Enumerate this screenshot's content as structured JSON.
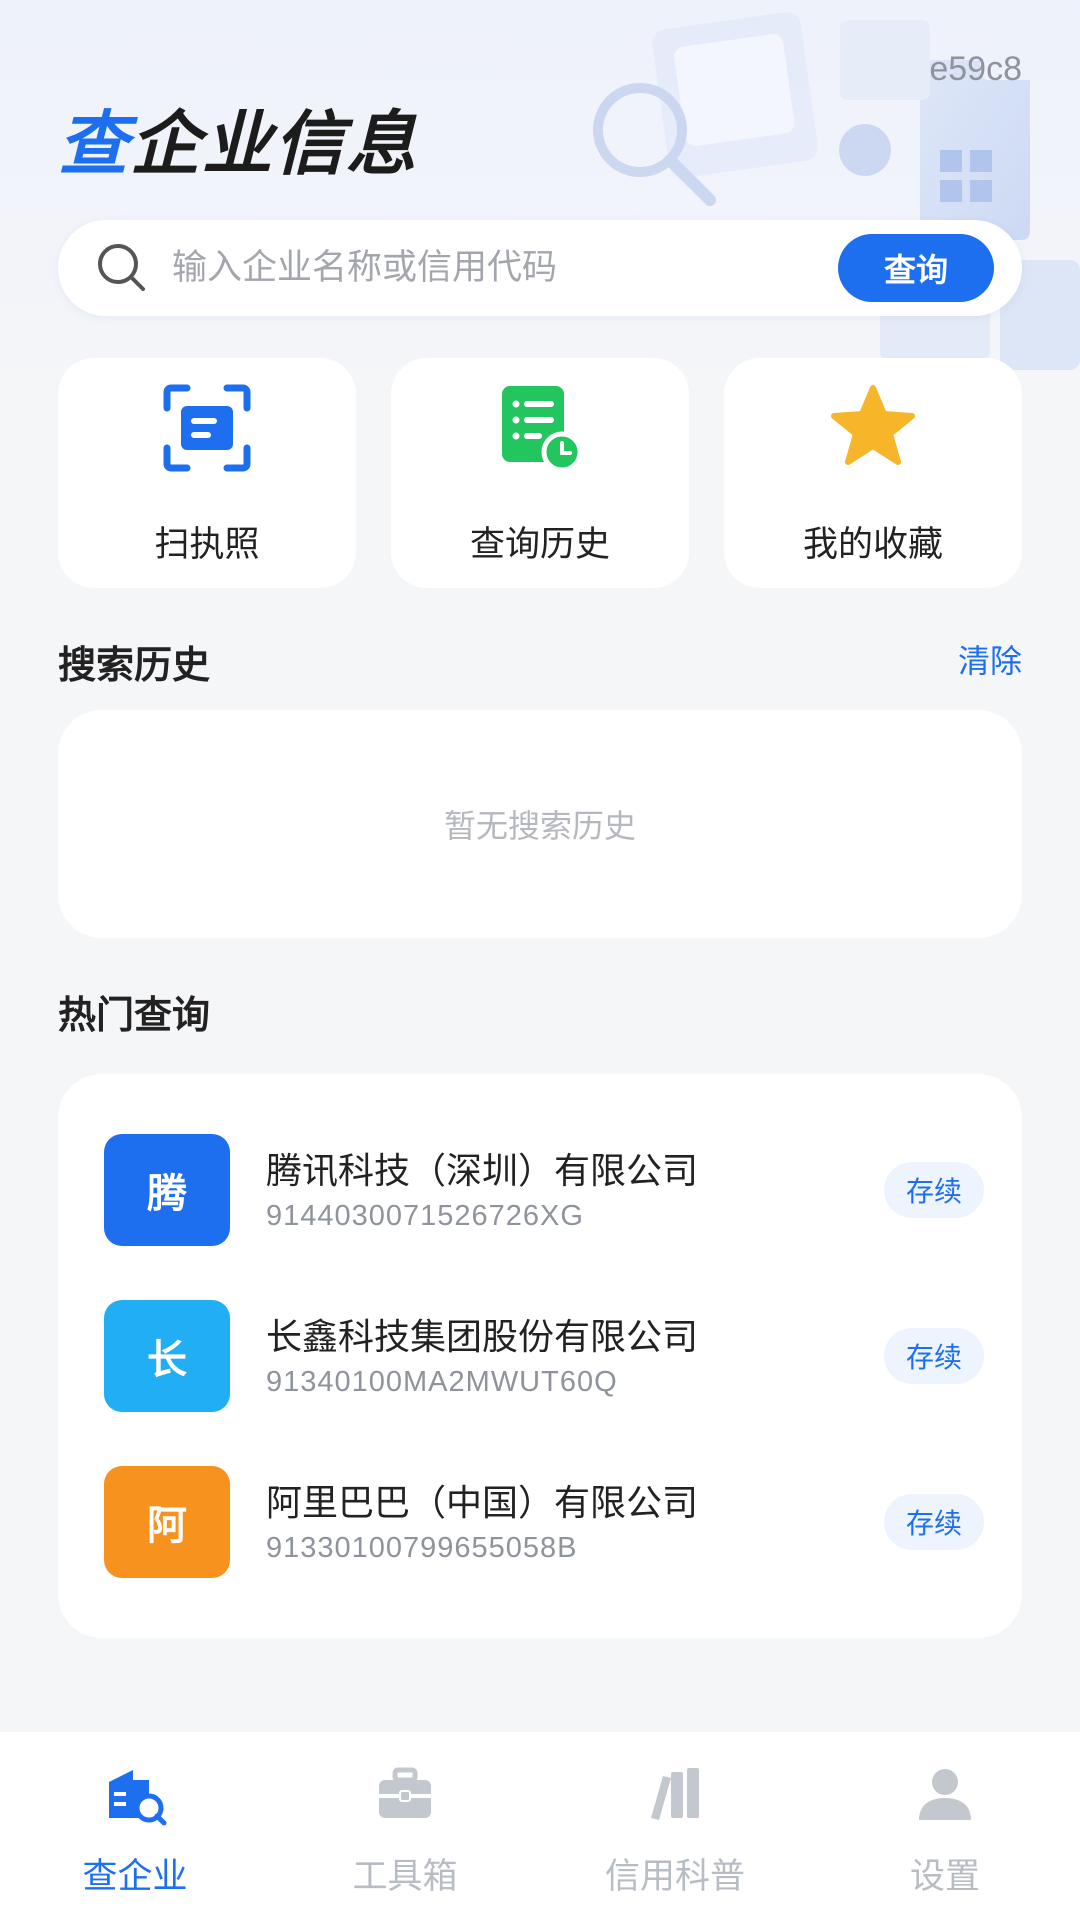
{
  "header": {
    "version": "e59c8",
    "title_accent": "查",
    "title_rest": "企业信息"
  },
  "search": {
    "placeholder": "输入企业名称或信用代码",
    "button_label": "查询"
  },
  "quick_actions": [
    {
      "label": "扫执照",
      "icon": "scan-license-icon"
    },
    {
      "label": "查询历史",
      "icon": "history-list-icon"
    },
    {
      "label": "我的收藏",
      "icon": "star-icon"
    }
  ],
  "history": {
    "title": "搜索历史",
    "clear_label": "清除",
    "empty_text": "暂无搜索历史"
  },
  "hot": {
    "title": "热门查询",
    "items": [
      {
        "initial": "腾",
        "name": "腾讯科技（深圳）有限公司",
        "code": "9144030071526726XG",
        "status": "存续",
        "color": "#1e6ff0"
      },
      {
        "initial": "长",
        "name": "长鑫科技集团股份有限公司",
        "code": "91340100MA2MWUT60Q",
        "status": "存续",
        "color": "#22aef5"
      },
      {
        "initial": "阿",
        "name": "阿里巴巴（中国）有限公司",
        "code": "91330100799655058B",
        "status": "存续",
        "color": "#f7921e"
      }
    ]
  },
  "tabbar": [
    {
      "label": "查企业",
      "icon": "company-search-icon",
      "active": true
    },
    {
      "label": "工具箱",
      "icon": "toolbox-icon",
      "active": false
    },
    {
      "label": "信用科普",
      "icon": "books-icon",
      "active": false
    },
    {
      "label": "设置",
      "icon": "user-icon",
      "active": false
    }
  ],
  "colors": {
    "accent": "#1e6ff0",
    "status_bg": "#eef4fd",
    "green": "#22c55e",
    "star": "#f7b529"
  }
}
